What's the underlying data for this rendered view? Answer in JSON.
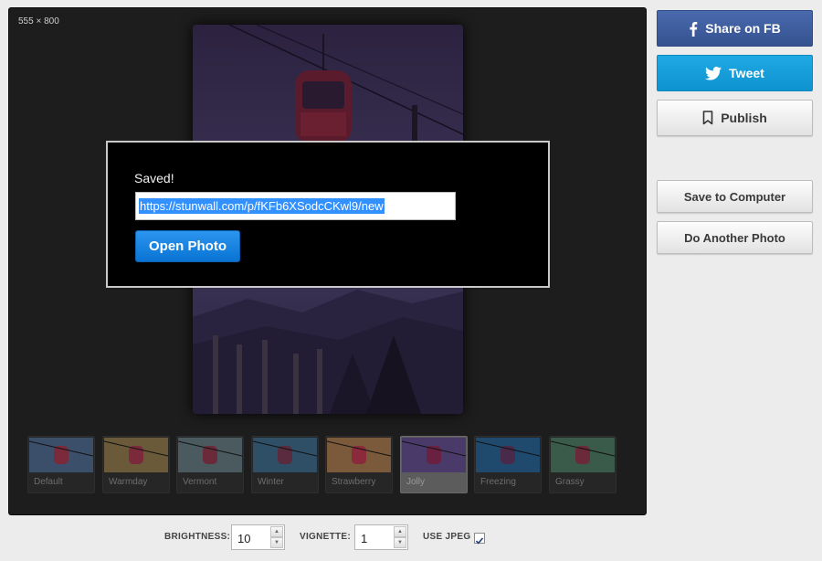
{
  "editor": {
    "dimensions": "555 × 800"
  },
  "dialog": {
    "saved_label": "Saved!",
    "url_value": "https://stunwall.com/p/fKFb6XSodcCKwl9/new",
    "open_button": "Open Photo"
  },
  "filters": [
    {
      "label": "Default",
      "tint": "#3b4f6a",
      "active": false
    },
    {
      "label": "Warmday",
      "tint": "#6a5a3a",
      "active": false
    },
    {
      "label": "Vermont",
      "tint": "#4a5a5e",
      "active": false
    },
    {
      "label": "Winter",
      "tint": "#2f4f66",
      "active": false
    },
    {
      "label": "Strawberry",
      "tint": "#7a5a3a",
      "active": false
    },
    {
      "label": "Jolly",
      "tint": "#4a3a6a",
      "active": true
    },
    {
      "label": "Freezing",
      "tint": "#1f4a6e",
      "active": false
    },
    {
      "label": "Grassy",
      "tint": "#3a5a4a",
      "active": false
    }
  ],
  "sidebar": {
    "share_fb": "Share on FB",
    "tweet": "Tweet",
    "publish": "Publish",
    "save_to_computer": "Save to Computer",
    "do_another": "Do Another Photo"
  },
  "controls": {
    "brightness_label": "BRIGHTNESS:",
    "brightness_value": "10",
    "vignette_label": "VIGNETTE:",
    "vignette_value": "1",
    "use_jpeg_label": "USE JPEG",
    "use_jpeg_checked": true
  },
  "colors": {
    "facebook": "#3b5998",
    "twitter": "#1da1e2",
    "primary_button": "#1a84e0",
    "selection": "#3390ff"
  }
}
